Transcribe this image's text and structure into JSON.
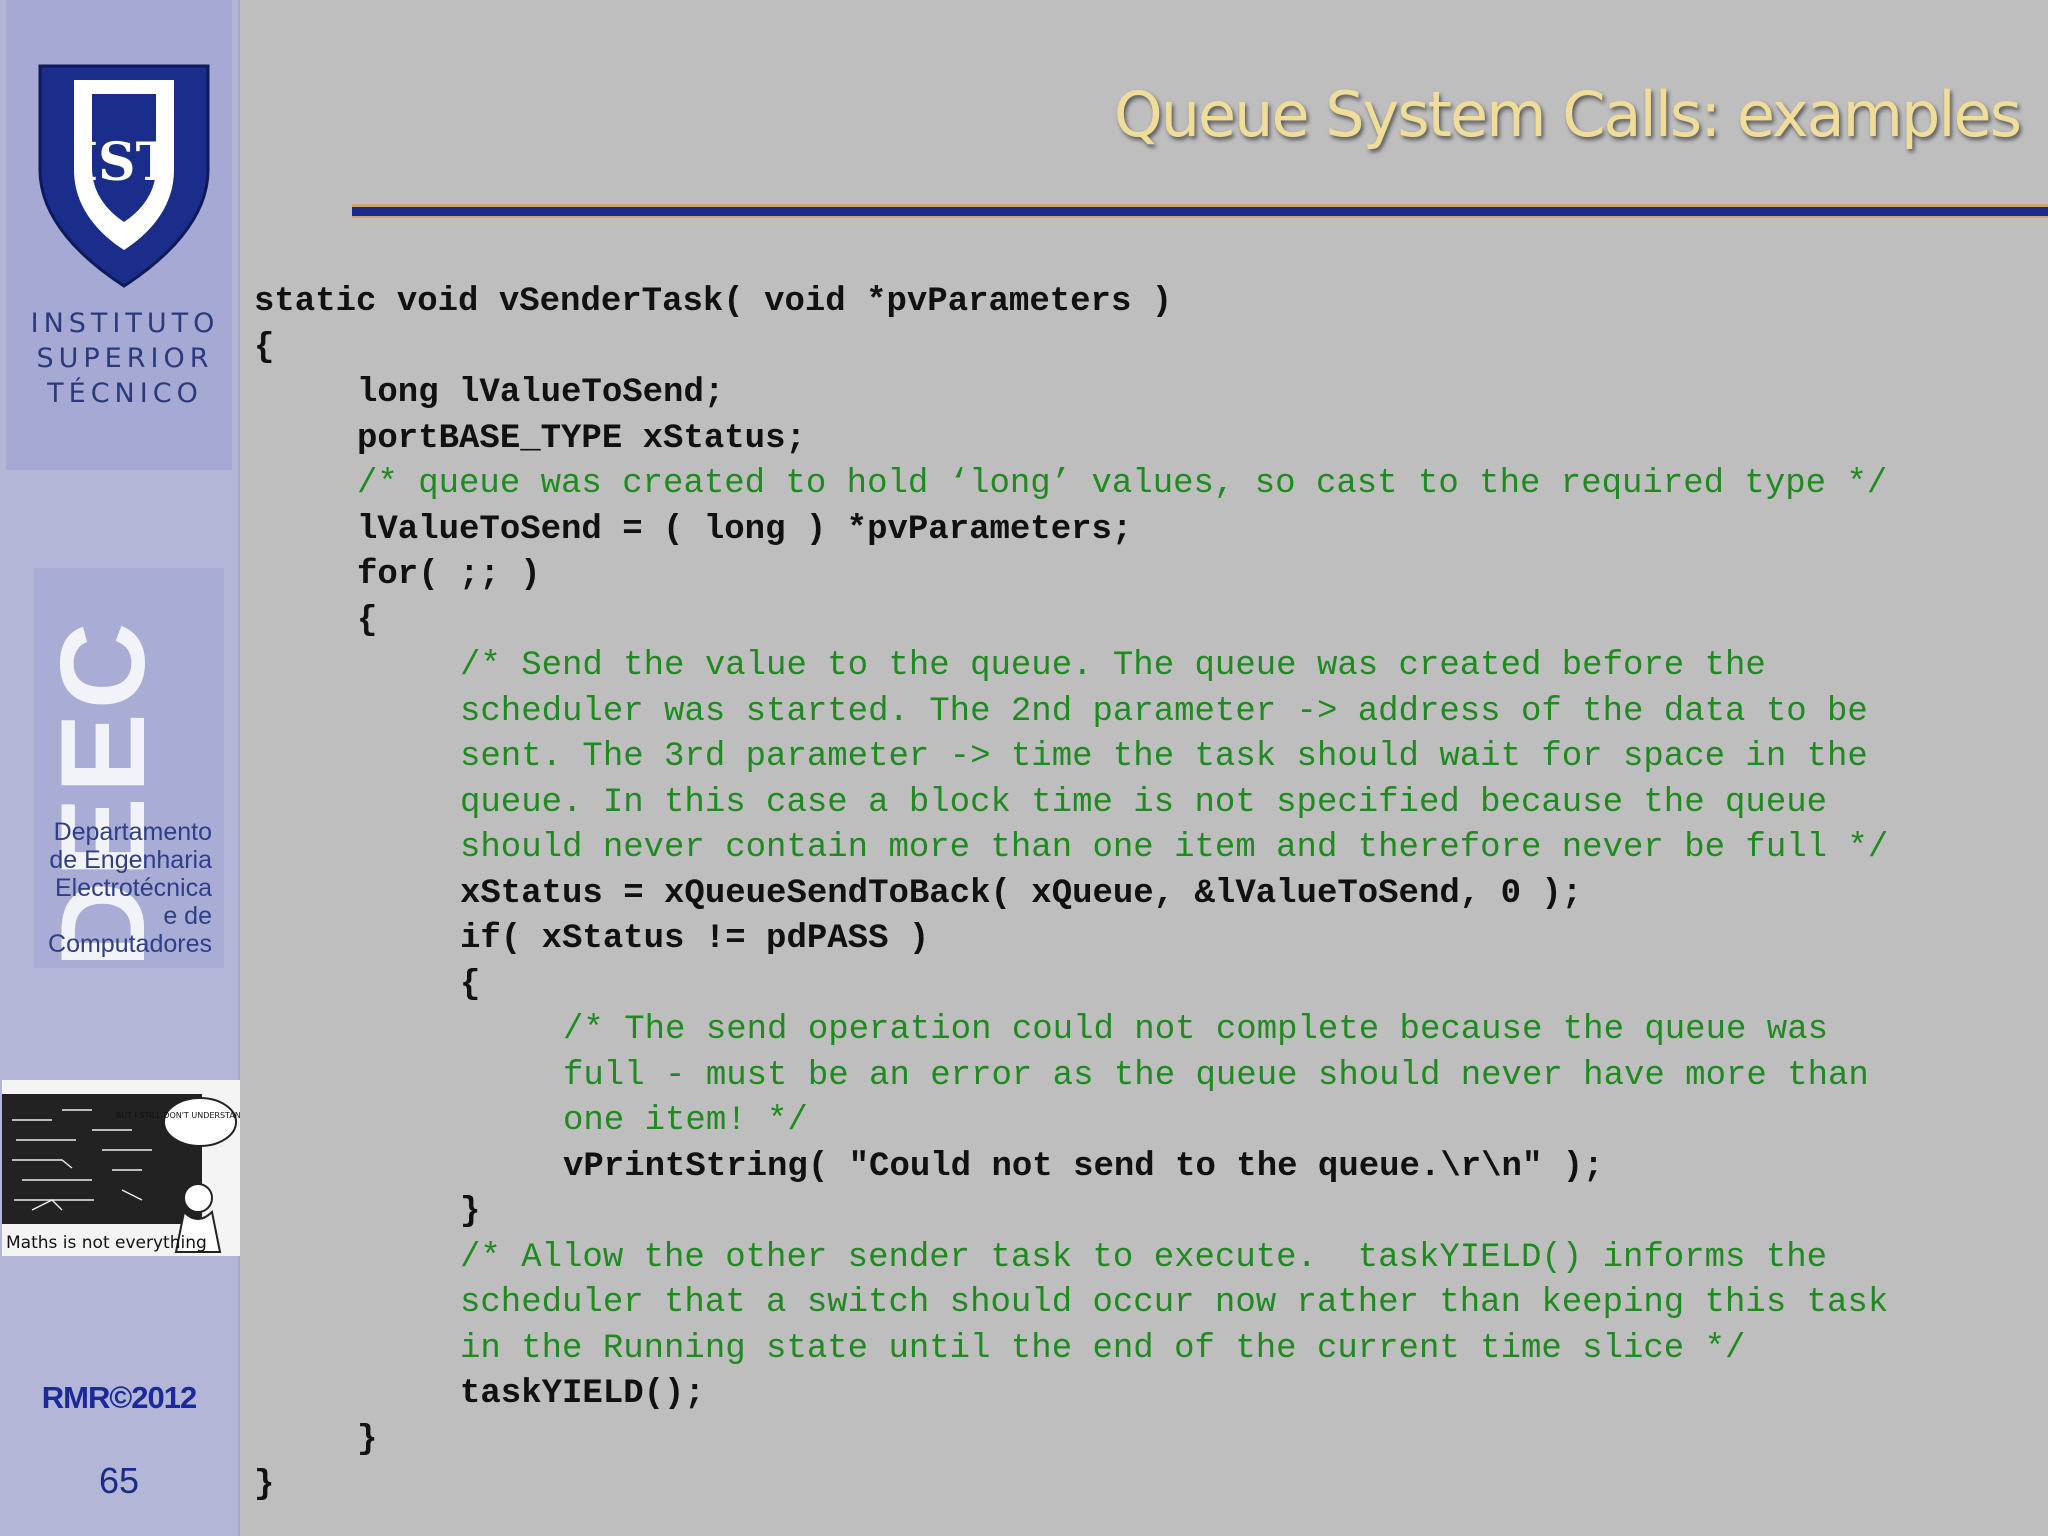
{
  "slide": {
    "title": "Queue System Calls: examples",
    "institution": {
      "lines": [
        "INSTITUTO",
        "SUPERIOR",
        "TÉCNICO"
      ],
      "logo_text": "IST"
    },
    "department": {
      "letters": "DEEC",
      "name_lines": [
        "Departamento",
        "de Engenharia",
        "Electrotécnica",
        "e de",
        "Computadores"
      ]
    },
    "comic": {
      "speech": "BUT I STILL DON'T UNDERSTAND WOMEN.",
      "caption": "Maths is not everything"
    },
    "copyright": "RMR©2012",
    "page_number": "65"
  },
  "code": {
    "lines": [
      {
        "indent": "",
        "kind": "code",
        "text": "static void vSenderTask( void *pvParameters )"
      },
      {
        "indent": "",
        "kind": "code",
        "text": "{"
      },
      {
        "indent": "   ",
        "kind": "code",
        "text": "long lValueToSend;"
      },
      {
        "indent": "   ",
        "kind": "code",
        "text": "portBASE_TYPE xStatus;"
      },
      {
        "indent": "   ",
        "kind": "comment",
        "text": "/* queue was created to hold ‘long’ values, so cast to the required type */"
      },
      {
        "indent": "   ",
        "kind": "code",
        "text": "lValueToSend = ( long ) *pvParameters;"
      },
      {
        "indent": "   ",
        "kind": "code",
        "text": "for( ;; )"
      },
      {
        "indent": "   ",
        "kind": "code",
        "text": "{"
      },
      {
        "indent": "      ",
        "kind": "comment",
        "text": "/* Send the value to the queue. The queue was created before the"
      },
      {
        "indent": "      ",
        "kind": "comment",
        "text": "scheduler was started. The 2nd parameter -> address of the data to be"
      },
      {
        "indent": "      ",
        "kind": "comment",
        "text": "sent. The 3rd parameter -> time the task should wait for space in the"
      },
      {
        "indent": "      ",
        "kind": "comment",
        "text": "queue. In this case a block time is not specified because the queue"
      },
      {
        "indent": "      ",
        "kind": "comment",
        "text": "should never contain more than one item and therefore never be full */"
      },
      {
        "indent": "      ",
        "kind": "code",
        "text": "xStatus = xQueueSendToBack( xQueue, &lValueToSend, 0 );"
      },
      {
        "indent": "      ",
        "kind": "code",
        "text": "if( xStatus != pdPASS )"
      },
      {
        "indent": "      ",
        "kind": "code",
        "text": "{"
      },
      {
        "indent": "         ",
        "kind": "comment",
        "text": "/* The send operation could not complete because the queue was"
      },
      {
        "indent": "         ",
        "kind": "comment",
        "text": "full - must be an error as the queue should never have more than"
      },
      {
        "indent": "         ",
        "kind": "comment",
        "text": "one item! */"
      },
      {
        "indent": "         ",
        "kind": "code",
        "text": "vPrintString( \"Could not send to the queue.\\r\\n\" );"
      },
      {
        "indent": "      ",
        "kind": "code",
        "text": "}"
      },
      {
        "indent": "      ",
        "kind": "comment",
        "text": "/* Allow the other sender task to execute.  taskYIELD() informs the"
      },
      {
        "indent": "      ",
        "kind": "comment",
        "text": "scheduler that a switch should occur now rather than keeping this task"
      },
      {
        "indent": "      ",
        "kind": "comment",
        "text": "in the Running state until the end of the current time slice */"
      },
      {
        "indent": "      ",
        "kind": "code",
        "text": "taskYIELD();"
      },
      {
        "indent": "   ",
        "kind": "code",
        "text": "}"
      },
      {
        "indent": "",
        "kind": "code",
        "text": "}"
      }
    ]
  },
  "colors": {
    "background": "#bebebe",
    "sidebar": "#b4b6d8",
    "title": "#f0dd9a",
    "comment": "#1f8a1f",
    "code": "#111111",
    "rule_blue": "#1b2a8c",
    "rule_gold": "#c8a86a"
  }
}
